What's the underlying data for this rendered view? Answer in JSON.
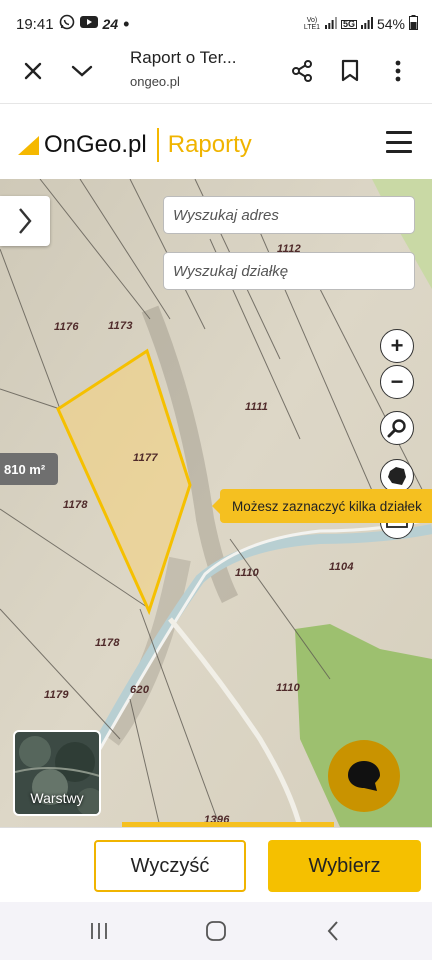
{
  "status_bar": {
    "time": "19:41",
    "notification_badge": "24",
    "network_label_1": "Vo) LTE1",
    "network_label_2": "5G",
    "battery": "54%"
  },
  "browser": {
    "page_title": "Raport o Ter...",
    "url": "ongeo.pl"
  },
  "site": {
    "logo_text": "OnGeo.pl",
    "section": "Raporty",
    "brand_color": "#f5b800"
  },
  "map": {
    "search_address_placeholder": "Wyszukaj adres",
    "search_parcel_placeholder": "Wyszukaj działkę",
    "area_badge": "810 m²",
    "tooltip": "Możesz zaznaczyć kilka działek",
    "layers_label": "Warstwy",
    "zoom_in": "+",
    "zoom_out": "−",
    "parcel_labels": [
      "1112",
      "1176",
      "1173",
      "1111",
      "1177",
      "1178",
      "1110",
      "1104",
      "1178",
      "1179",
      "620",
      "1110",
      "1396"
    ]
  },
  "actions": {
    "clear_label": "Wyczyść",
    "select_label": "Wybierz"
  }
}
